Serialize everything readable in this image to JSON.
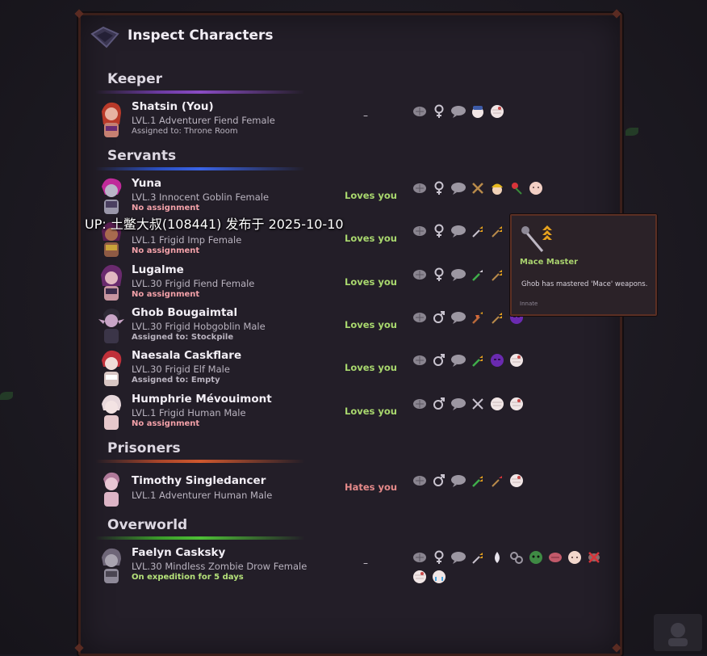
{
  "window": {
    "title": "Inspect Characters"
  },
  "sections": {
    "keeper": "Keeper",
    "servants": "Servants",
    "prisoners": "Prisoners",
    "overworld": "Overworld"
  },
  "characters": [
    {
      "name": "Shatsin (You)",
      "sub": "LVL.1 Adventurer Fiend Female",
      "assignment": "Assigned to: Throne Room",
      "relation": "–"
    },
    {
      "name": "Yuna",
      "sub": "LVL.3 Innocent Goblin Female",
      "assignment": "No assignment",
      "relation": "Loves you"
    },
    {
      "name": "",
      "sub": "LVL.1 Frigid Imp Female",
      "assignment": "No assignment",
      "relation": "Loves you"
    },
    {
      "name": "Lugalme",
      "sub": "LVL.30 Frigid Fiend Female",
      "assignment": "No assignment",
      "relation": "Loves you"
    },
    {
      "name": "Ghob Bougaimtal",
      "sub": "LVL.30 Frigid Hobgoblin Male",
      "assignment": "Assigned to: Stockpile",
      "relation": "Loves you"
    },
    {
      "name": "Naesala Caskflare",
      "sub": "LVL.30 Frigid Elf Male",
      "assignment": "Assigned to: Empty",
      "relation": "Loves you"
    },
    {
      "name": "Humphrie Mévouimont",
      "sub": "LVL.1 Frigid Human Male",
      "assignment": "No assignment",
      "relation": "Loves you"
    },
    {
      "name": "Timothy Singledancer",
      "sub": "LVL.1 Adventurer Human Male",
      "assignment": "",
      "relation": "Hates you"
    },
    {
      "name": "Faelyn Casksky",
      "sub": "LVL.30 Mindless Zombie Drow Female",
      "assignment": "On expedition for 5 days",
      "relation": "–"
    }
  ],
  "tooltip": {
    "title": "Mace Master",
    "description": "Ghob has mastered 'Mace' weapons.",
    "tag": "Innate"
  },
  "watermark": "UP: 土鳖大叔(108441) 发布于 2025-10-10",
  "colors": {
    "loves": "#a9d86e",
    "hates": "#e58a8a",
    "no_assignment": "#f2a0a8",
    "assigned": "#b9b3bf",
    "expedition": "#b5e27a"
  }
}
